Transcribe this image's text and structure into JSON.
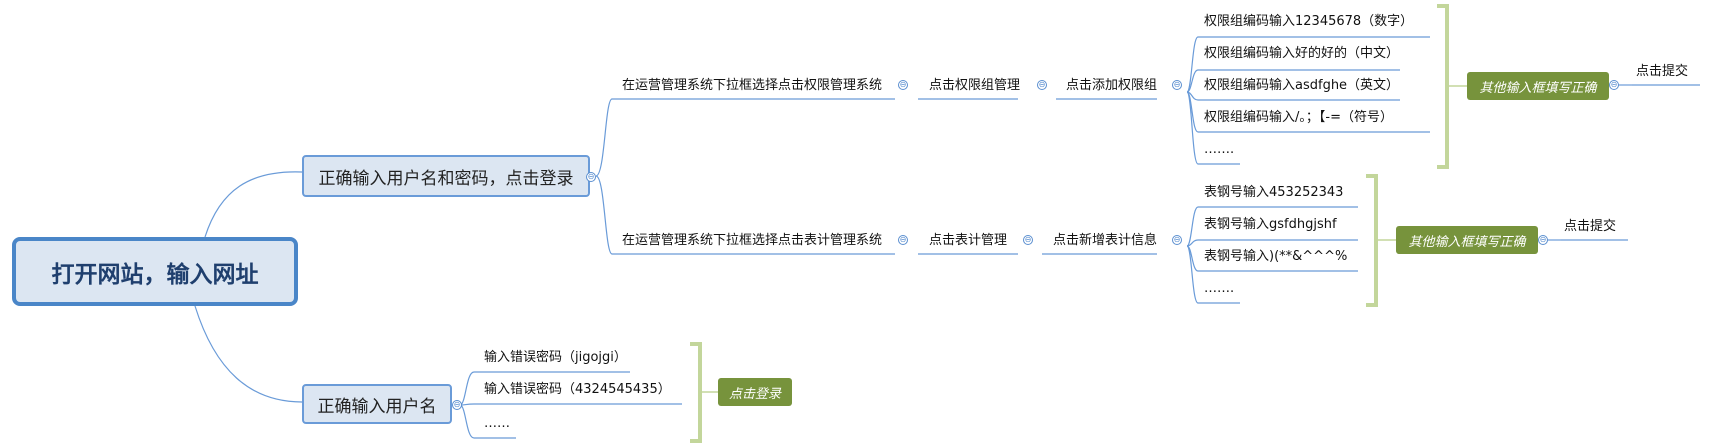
{
  "root": "打开网站，输入网址",
  "branch1": {
    "label": "正确输入用户名和密码，点击登录",
    "path_a": {
      "step1": "在运营管理系统下拉框选择点击权限管理系统",
      "step2": "点击权限组管理",
      "step3": "点击添加权限组",
      "inputs": [
        "权限组编码输入12345678（数字）",
        "权限组编码输入好的好的（中文）",
        "权限组编码输入asdfghe（英文）",
        "权限组编码输入/。；【-=（符号）",
        "……."
      ],
      "summary": "其他输入框填写正确",
      "final": "点击提交"
    },
    "path_b": {
      "step1": "在运营管理系统下拉框选择点击表计管理系统",
      "step2": "点击表计管理",
      "step3": "点击新增表计信息",
      "inputs": [
        "表钢号输入453252343",
        "表钢号输入gsfdhgjshf",
        "表钢号输入)(**&^^^%",
        "……."
      ],
      "summary": "其他输入框填写正确",
      "final": "点击提交"
    }
  },
  "branch2": {
    "label": "正确输入用户名",
    "inputs": [
      "输入错误密码（jigojgi）",
      "输入错误密码（4324545435）",
      "……"
    ],
    "summary": "点击登录"
  },
  "colors": {
    "root_border": "#4a86c8",
    "box_fill": "#dce6f2",
    "connector": "#5b8fd0",
    "summary_fill": "#77933c",
    "bracket": "#c3d69b"
  },
  "collapse_symbol": "⊖"
}
